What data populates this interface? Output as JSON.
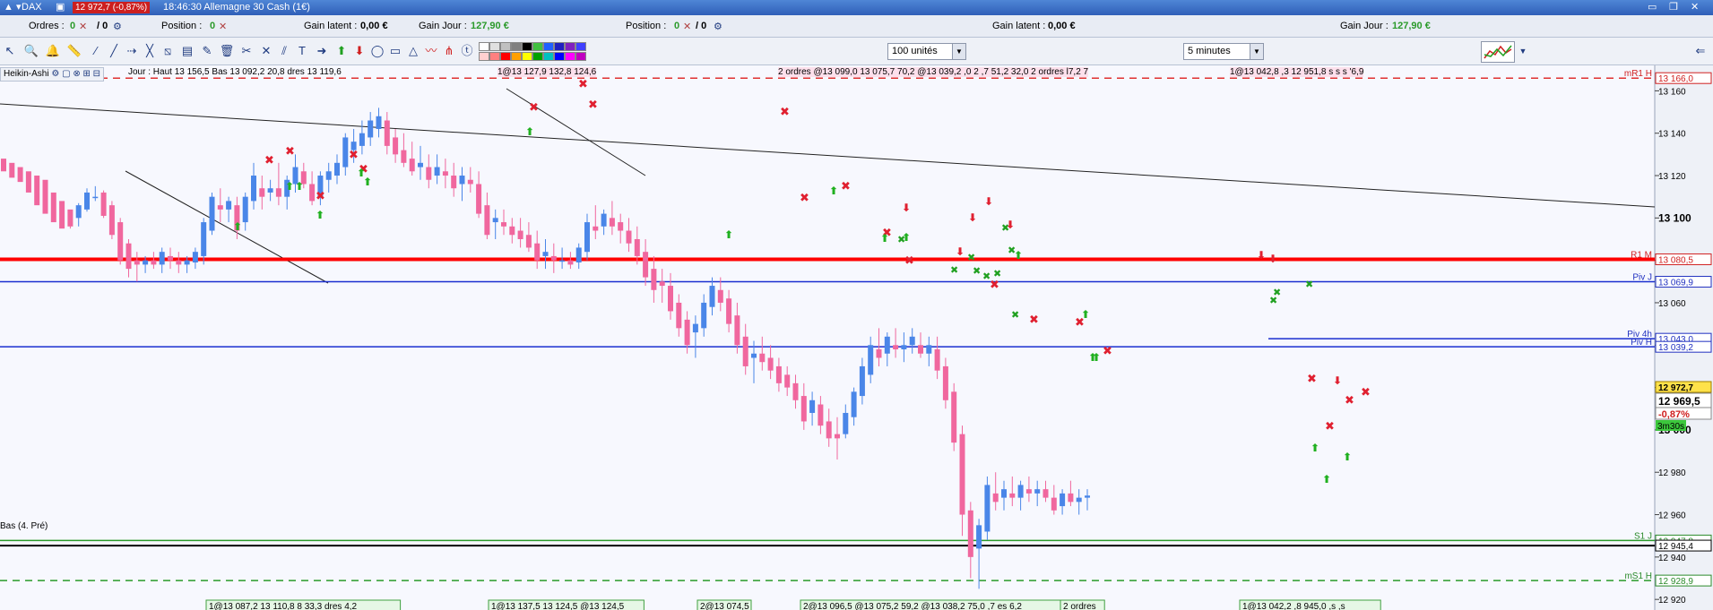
{
  "titlebar": {
    "instrument": "DAX",
    "price_change": "12 972,7 (-0,87%)",
    "window_title": "18:46:30 Allemagne 30 Cash (1€)"
  },
  "infobar": {
    "orders_label": "Ordres :",
    "orders_value": "0",
    "orders_sep": "/ 0",
    "position_label": "Position :",
    "position_value": "0",
    "gain_latent_label": "Gain latent :",
    "gain_latent_value": "0,00 €",
    "gain_jour_label": "Gain Jour :",
    "gain_jour_value": "127,90 €",
    "position2_label": "Position :",
    "position2_value": "0",
    "position2_sep": "/ 0",
    "gain_latent2_label": "Gain latent :",
    "gain_latent2_value": "0,00 €",
    "gain_jour2_label": "Gain Jour :",
    "gain_jour2_value": "127,90 €"
  },
  "toolbar": {
    "units_select": "100 unités",
    "timeframe_select": "5 minutes"
  },
  "chart_header": {
    "style_label": "Heikin-Ashi",
    "day_info": "Jour : Haut 13 156,5  Bas 13 092,2  20,8  dres 13 119,6",
    "ann1": "1@13 127,9  132,8  124,6",
    "ann2": "2 ordres @13 099,0  13 075,7 70,2  @13 039,2 ,0  2 ,7 51,2 32,0  2 ordres l7,2 7",
    "ann3": "1@13 042,8 ,3  12 951,8  s s  s '6,9"
  },
  "bottom_annotations": [
    "1@13 087,2  13 110,8  8 33,3  dres  4,2",
    "1@13 137,5  13 124,5  @13 124,5",
    "2@13 074,5",
    "2@13 096,5  @13 075,2  59,2  @13 038,2  75,0 ,7  es  6,2",
    "2 ordres",
    "1@13 042,2 ,8  945,0  ,s  ,s"
  ],
  "left_label": "Bas (4. Pré)",
  "price_axis": {
    "ticks": [
      "13 160",
      "13 140",
      "13 120",
      "13 100",
      "13 080",
      "13 060",
      "13 040",
      "13 020",
      "13 000",
      "12 980",
      "12 960",
      "12 940",
      "12 920"
    ],
    "level_boxes": [
      {
        "label": "mR1 H",
        "value": "13 166,0",
        "color": "#d02020"
      },
      {
        "label": "R1 M",
        "value": "13 080,5",
        "color": "#d02020"
      },
      {
        "label": "Piv J",
        "value": "13 069,9",
        "color": "#2030c0"
      },
      {
        "label": "Piv 4h",
        "value": "13 043,0",
        "color": "#2030c0"
      },
      {
        "label": "Piv H",
        "value": "13 039,2",
        "color": "#2030c0"
      },
      {
        "label": "S1 J",
        "value": "12 947,8",
        "color": "#2a8a2a"
      },
      {
        "label": "",
        "value": "12 945,4",
        "color": "#000000"
      },
      {
        "label": "mS1 H",
        "value": "12 928,9",
        "color": "#2a8a2a"
      }
    ],
    "current_price": "12 969,5",
    "last_price": "12 972,7",
    "change_pct": "-0,87%",
    "countdown": "3m30s"
  },
  "chart_data": {
    "type": "candlestick",
    "style": "Heikin-Ashi",
    "ylim": [
      12915,
      13172
    ],
    "x_count": 180,
    "candles": [
      [
        13128,
        13126,
        13124,
        13122
      ],
      [
        13126,
        13124,
        13121,
        13119
      ],
      [
        13124,
        13122,
        13118,
        13117
      ],
      [
        13122,
        13120,
        13113,
        13112
      ],
      [
        13120,
        13118,
        13108,
        13106
      ],
      [
        13118,
        13116,
        13104,
        13102
      ],
      [
        13112,
        13110,
        13100,
        13098
      ],
      [
        13108,
        13106,
        13097,
        13095
      ],
      [
        13104,
        13102,
        13095,
        13096
      ],
      [
        13100,
        13107,
        13096,
        13106
      ],
      [
        13104,
        13114,
        13103,
        13112
      ],
      [
        13110,
        13115,
        13108,
        13110
      ],
      [
        13112,
        13113,
        13100,
        13101
      ],
      [
        13106,
        13108,
        13090,
        13092
      ],
      [
        13098,
        13100,
        13078,
        13080
      ],
      [
        13088,
        13090,
        13072,
        13076
      ],
      [
        13080,
        13084,
        13070,
        13078
      ],
      [
        13078,
        13082,
        13074,
        13080
      ],
      [
        13080,
        13084,
        13076,
        13078
      ],
      [
        13078,
        13086,
        13074,
        13084
      ],
      [
        13082,
        13086,
        13076,
        13080
      ],
      [
        13080,
        13084,
        13074,
        13078
      ],
      [
        13078,
        13082,
        13074,
        13080
      ],
      [
        13079,
        13086,
        13076,
        13084
      ],
      [
        13082,
        13100,
        13078,
        13098
      ],
      [
        13094,
        13112,
        13092,
        13110
      ],
      [
        13106,
        13114,
        13098,
        13104
      ],
      [
        13104,
        13110,
        13098,
        13108
      ],
      [
        13106,
        13110,
        13090,
        13094
      ],
      [
        13098,
        13112,
        13094,
        13110
      ],
      [
        13108,
        13126,
        13104,
        13120
      ],
      [
        13114,
        13120,
        13104,
        13110
      ],
      [
        13112,
        13118,
        13108,
        13114
      ],
      [
        13114,
        13126,
        13106,
        13110
      ],
      [
        13110,
        13120,
        13104,
        13118
      ],
      [
        13116,
        13130,
        13112,
        13124
      ],
      [
        13122,
        13126,
        13114,
        13116
      ],
      [
        13116,
        13122,
        13106,
        13108
      ],
      [
        13110,
        13122,
        13106,
        13120
      ],
      [
        13118,
        13126,
        13112,
        13122
      ],
      [
        13120,
        13130,
        13116,
        13126
      ],
      [
        13124,
        13140,
        13120,
        13138
      ],
      [
        13132,
        13142,
        13126,
        13136
      ],
      [
        13134,
        13146,
        13130,
        13140
      ],
      [
        13138,
        13150,
        13134,
        13146
      ],
      [
        13142,
        13152,
        13138,
        13148
      ],
      [
        13146,
        13150,
        13130,
        13134
      ],
      [
        13138,
        13142,
        13126,
        13130
      ],
      [
        13132,
        13140,
        13124,
        13126
      ],
      [
        13128,
        13136,
        13120,
        13122
      ],
      [
        13124,
        13134,
        13118,
        13126
      ],
      [
        13124,
        13130,
        13114,
        13118
      ],
      [
        13120,
        13130,
        13116,
        13124
      ],
      [
        13122,
        13128,
        13114,
        13120
      ],
      [
        13120,
        13126,
        13110,
        13114
      ],
      [
        13116,
        13124,
        13108,
        13120
      ],
      [
        13118,
        13124,
        13112,
        13116
      ],
      [
        13116,
        13122,
        13100,
        13102
      ],
      [
        13106,
        13112,
        13090,
        13092
      ],
      [
        13098,
        13104,
        13090,
        13100
      ],
      [
        13098,
        13104,
        13092,
        13096
      ],
      [
        13096,
        13100,
        13088,
        13092
      ],
      [
        13094,
        13100,
        13086,
        13090
      ],
      [
        13092,
        13098,
        13084,
        13086
      ],
      [
        13088,
        13094,
        13076,
        13080
      ],
      [
        13082,
        13090,
        13076,
        13084
      ],
      [
        13082,
        13088,
        13074,
        13080
      ],
      [
        13080,
        13086,
        13076,
        13080
      ],
      [
        13080,
        13084,
        13076,
        13078
      ],
      [
        13079,
        13088,
        13076,
        13086
      ],
      [
        13084,
        13102,
        13080,
        13098
      ],
      [
        13096,
        13106,
        13090,
        13094
      ],
      [
        13096,
        13104,
        13092,
        13102
      ],
      [
        13100,
        13108,
        13092,
        13096
      ],
      [
        13098,
        13102,
        13088,
        13094
      ],
      [
        13094,
        13100,
        13084,
        13088
      ],
      [
        13090,
        13096,
        13078,
        13082
      ],
      [
        13084,
        13090,
        13068,
        13072
      ],
      [
        13076,
        13082,
        13060,
        13066
      ],
      [
        13070,
        13076,
        13060,
        13068
      ],
      [
        13068,
        13074,
        13052,
        13056
      ],
      [
        13060,
        13064,
        13044,
        13048
      ],
      [
        13052,
        13056,
        13036,
        13040
      ],
      [
        13046,
        13054,
        13034,
        13050
      ],
      [
        13048,
        13064,
        13044,
        13060
      ],
      [
        13058,
        13072,
        13054,
        13068
      ],
      [
        13066,
        13072,
        13056,
        13060
      ],
      [
        13062,
        13066,
        13046,
        13050
      ],
      [
        13054,
        13060,
        13036,
        13040
      ],
      [
        13044,
        13050,
        13026,
        13030
      ],
      [
        13034,
        13042,
        13022,
        13036
      ],
      [
        13036,
        13044,
        13028,
        13032
      ],
      [
        13034,
        13040,
        13024,
        13028
      ],
      [
        13030,
        13034,
        13018,
        13022
      ],
      [
        13026,
        13030,
        13016,
        13020
      ],
      [
        13022,
        13026,
        13010,
        13014
      ],
      [
        13016,
        13022,
        13000,
        13004
      ],
      [
        13008,
        13018,
        13002,
        13014
      ],
      [
        13012,
        13016,
        12998,
        13002
      ],
      [
        13004,
        13010,
        12992,
        12996
      ],
      [
        12998,
        13006,
        12986,
        12996
      ],
      [
        12998,
        13012,
        12996,
        13008
      ],
      [
        13006,
        13020,
        13002,
        13018
      ],
      [
        13016,
        13034,
        13012,
        13030
      ],
      [
        13026,
        13044,
        13022,
        13040
      ],
      [
        13038,
        13048,
        13030,
        13034
      ],
      [
        13036,
        13046,
        13030,
        13044
      ],
      [
        13040,
        13048,
        13034,
        13038
      ],
      [
        13038,
        13046,
        13032,
        13040
      ],
      [
        13040,
        13048,
        13036,
        13044
      ],
      [
        13040,
        13046,
        13034,
        13036
      ],
      [
        13036,
        13044,
        13030,
        13040
      ],
      [
        13038,
        13044,
        13024,
        13028
      ],
      [
        13030,
        13034,
        13010,
        13014
      ],
      [
        13018,
        13022,
        12990,
        12994
      ],
      [
        12998,
        13002,
        12950,
        12960
      ],
      [
        12962,
        12966,
        12930,
        12940
      ],
      [
        12944,
        12958,
        12925,
        12955
      ],
      [
        12952,
        12978,
        12948,
        12974
      ],
      [
        12970,
        12980,
        12962,
        12966
      ],
      [
        12968,
        12976,
        12962,
        12972
      ],
      [
        12970,
        12978,
        12964,
        12968
      ],
      [
        12968,
        12976,
        12962,
        12974
      ],
      [
        12972,
        12978,
        12966,
        12970
      ],
      [
        12970,
        12976,
        12964,
        12972
      ],
      [
        12972,
        12976,
        12966,
        12968
      ],
      [
        12968,
        12974,
        12960,
        12962
      ],
      [
        12964,
        12972,
        12960,
        12970
      ],
      [
        12970,
        12976,
        12964,
        12966
      ],
      [
        12966,
        12972,
        12960,
        12968
      ],
      [
        12968,
        12972,
        12962,
        12969
      ]
    ],
    "candle_x_start": 4,
    "candle_spacing": 9.3,
    "series_colors": {
      "up": "#4a86e8",
      "down": "#f0679e"
    },
    "levels": [
      {
        "name": "mR1 H",
        "value": 13166.0,
        "color": "#e03030",
        "style": "dashed"
      },
      {
        "name": "R1 M",
        "value": 13080.5,
        "color": "#ff0000",
        "style": "thick"
      },
      {
        "name": "Piv J",
        "value": 13069.9,
        "color": "#1a2ed0",
        "style": "solid"
      },
      {
        "name": "Piv 4h",
        "value": 13043.0,
        "color": "#1a2ed0",
        "style": "solid"
      },
      {
        "name": "Piv H",
        "value": 13039.2,
        "color": "#1a2ed0",
        "style": "solid"
      },
      {
        "name": "S1 J",
        "value": 12947.8,
        "color": "#2a9a2a",
        "style": "solid"
      },
      {
        "name": "Bas",
        "value": 12945.4,
        "color": "#000000",
        "style": "solid"
      },
      {
        "name": "mS1 H",
        "value": 12928.9,
        "color": "#2a9a2a",
        "style": "dashed"
      }
    ]
  }
}
